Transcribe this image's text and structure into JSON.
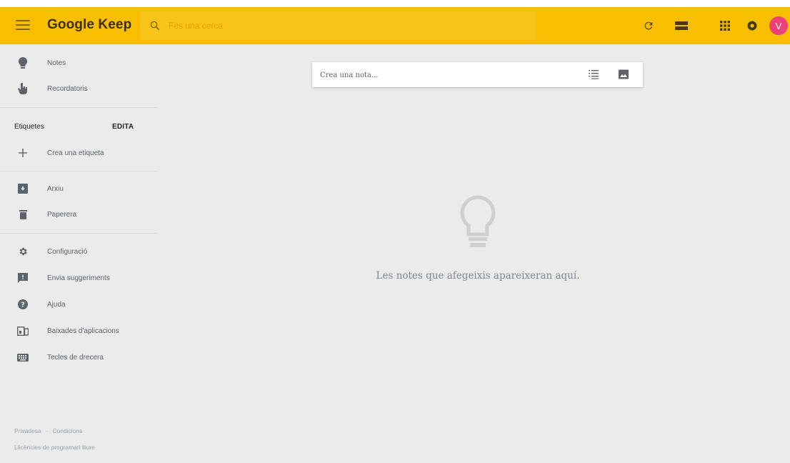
{
  "header": {
    "brand": "Google Keep",
    "search_placeholder": "Fes una cerca",
    "avatar_letter": "V",
    "colors": {
      "bar": "#f8bf00",
      "avatar": "#ec407a"
    },
    "icons": [
      "menu-icon",
      "search-icon",
      "refresh-icon",
      "list-view-icon",
      "apps-grid-icon",
      "notifications-icon"
    ]
  },
  "sidebar": {
    "top_items": [
      {
        "label": "Notes",
        "icon": "lightbulb-icon"
      },
      {
        "label": "Recordatoris",
        "icon": "reminder-hand-icon"
      }
    ],
    "labels_heading": "Etiquetes",
    "edit_label": "EDITA",
    "create_label": {
      "label": "Crea una etiqueta",
      "icon": "plus-icon"
    },
    "mid_items": [
      {
        "label": "Arxiu",
        "icon": "archive-icon"
      },
      {
        "label": "Paperera",
        "icon": "trash-icon"
      }
    ],
    "bottom_items": [
      {
        "label": "Configuració",
        "icon": "gear-icon"
      },
      {
        "label": "Envia suggeriments",
        "icon": "feedback-icon"
      },
      {
        "label": "Ajuda",
        "icon": "help-icon"
      },
      {
        "label": "Baixades d'aplicacions",
        "icon": "devices-icon"
      },
      {
        "label": "Tecles de drecera",
        "icon": "keyboard-icon"
      }
    ],
    "footer": {
      "privacy": "Privadesa",
      "separator": "·",
      "terms": "Condicions",
      "licenses": "Llicències de programari lliure"
    }
  },
  "main": {
    "note_placeholder": "Crea una nota...",
    "empty_text": "Les notes que afegeixis apareixeran aquí."
  }
}
